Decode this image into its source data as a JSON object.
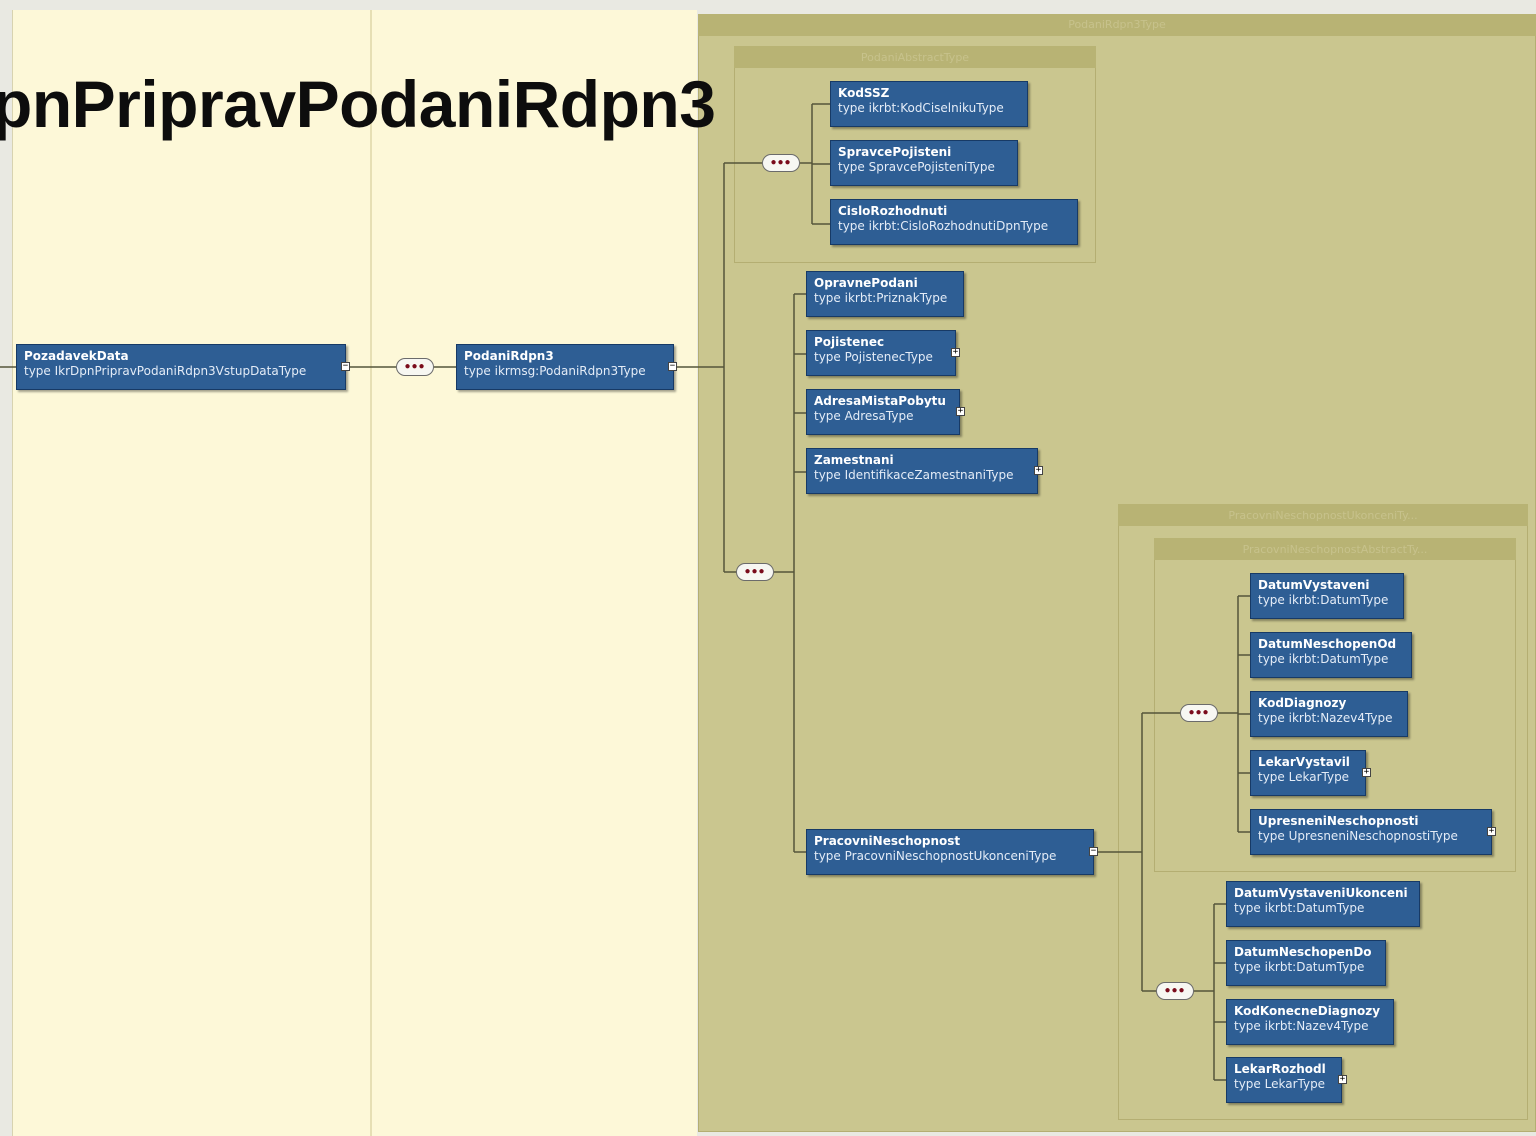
{
  "title": "pnPripravPodaniRdpn3",
  "groups": {
    "outer": "PodaniRdpn3Type",
    "abstract": "PodaniAbstractType",
    "ukonceni": "PracovniNeschopnostUkonceniTy...",
    "neschop_abstract": "PracovniNeschopnostAbstractTy..."
  },
  "sequence_glyph": "●●●",
  "expand_glyph": "+",
  "collapse_glyph": "−",
  "nodes": {
    "pozadavek": {
      "name": "PozadavekData",
      "type": "type  IkrDpnPripravPodaniRdpn3VstupDataType"
    },
    "podani": {
      "name": "PodaniRdpn3",
      "type": "type  ikrmsg:PodaniRdpn3Type"
    },
    "kodssz": {
      "name": "KodSSZ",
      "type": "type  ikrbt:KodCiselnikuType"
    },
    "spravce": {
      "name": "SpravcePojisteni",
      "type": "type  SpravcePojisteniType"
    },
    "cislo": {
      "name": "CisloRozhodnuti",
      "type": "type  ikrbt:CisloRozhodnutiDpnType"
    },
    "opravne": {
      "name": "OpravnePodani",
      "type": "type  ikrbt:PriznakType"
    },
    "pojistenec": {
      "name": "Pojistenec",
      "type": "type  PojistenecType"
    },
    "adresa": {
      "name": "AdresaMistaPobytu",
      "type": "type  AdresaType"
    },
    "zamestnani": {
      "name": "Zamestnani",
      "type": "type  IdentifikaceZamestnaniType"
    },
    "pracovni": {
      "name": "PracovniNeschopnost",
      "type": "type  PracovniNeschopnostUkonceniType"
    },
    "datumvyst": {
      "name": "DatumVystaveni",
      "type": "type  ikrbt:DatumType"
    },
    "datumod": {
      "name": "DatumNeschopenOd",
      "type": "type  ikrbt:DatumType"
    },
    "koddiag": {
      "name": "KodDiagnozy",
      "type": "type  ikrbt:Nazev4Type"
    },
    "lekarvyst": {
      "name": "LekarVystavil",
      "type": "type  LekarType"
    },
    "upresneni": {
      "name": "UpresneniNeschopnosti",
      "type": "type  UpresneniNeschopnostiType"
    },
    "datumukon": {
      "name": "DatumVystaveniUkonceni",
      "type": "type  ikrbt:DatumType"
    },
    "datumdo": {
      "name": "DatumNeschopenDo",
      "type": "type  ikrbt:DatumType"
    },
    "kodkonec": {
      "name": "KodKonecneDiagnozy",
      "type": "type  ikrbt:Nazev4Type"
    },
    "lekarrozh": {
      "name": "LekarRozhodl",
      "type": "type  LekarType"
    }
  },
  "colors": {
    "left_panel": "#fdf8d8",
    "outer_group": "#cac68f",
    "group_header": "#b8b374",
    "node": "#2e5e94",
    "connector": "#5a5a3a"
  }
}
